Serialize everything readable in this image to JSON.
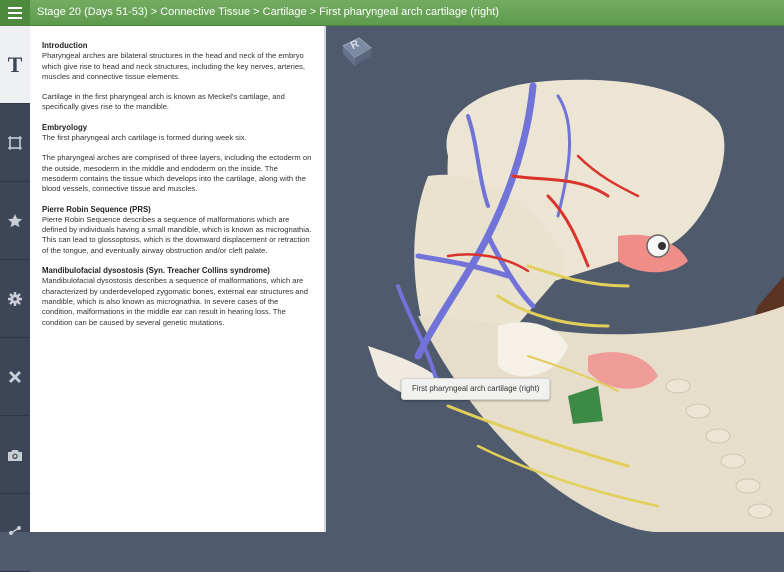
{
  "header": {
    "breadcrumb": "Stage 20 (Days 51-53) > Connective Tissue > Cartilage > First pharyngeal arch cartilage (right)"
  },
  "sidebar": {
    "items": [
      {
        "id": "text",
        "icon": "text-icon",
        "label": "T",
        "active": true
      },
      {
        "id": "views",
        "icon": "frame-icon"
      },
      {
        "id": "favorites",
        "icon": "star-icon"
      },
      {
        "id": "settings",
        "icon": "gear-icon"
      },
      {
        "id": "tools",
        "icon": "cross-tools-icon"
      },
      {
        "id": "camera",
        "icon": "camera-icon"
      },
      {
        "id": "share",
        "icon": "share-icon"
      }
    ]
  },
  "content": {
    "intro_heading": "Introduction",
    "intro_p1": "Pharyngeal arches are bilateral structures in the head and neck of the embryo which give rise to head and neck structures, including the key nerves, arteries, muscles and connective tissue elements.",
    "intro_p2": "Cartilage in the first pharyngeal arch is known as Meckel's cartilage, and specifically gives rise to the mandible.",
    "embryology_heading": "Embryology",
    "embryology_p1": "The first pharyngeal arch cartilage is formed during week six.",
    "embryology_p2": "The pharyngeal arches are comprised of three layers, including the ectoderm on the outside, mesoderm in the middle and endoderm on the inside. The mesoderm contains the tissue which develops into the cartilage, along with the blood vessels, connective tissue and muscles.",
    "prs_heading": "Pierre Robin Sequence (PRS)",
    "prs_p": "Pierre Robin Sequence describes a sequence of malformations which are defined by individuals having a small mandible, which is known as micrognathia. This can lead to glossoptosis, which is the downward displacement or retraction of the tongue, and eventually airway obstruction and/or cleft palate.",
    "md_heading": "Mandibulofacial dysostosis (Syn. Treacher Collins syndrome)",
    "md_p": "Mandibulofacial dysostosis describes a sequence of malformations, which are characterized by underdeveloped zygomatic bones, external ear structures and mandible, which is also known as micrognathia. In severe cases of the condition, malformations in the middle ear can result in hearing loss. The condition can be caused by several genetic mutations."
  },
  "viewer": {
    "orientation_cube_label": "R",
    "tooltip": "First pharyngeal arch cartilage (right)"
  },
  "colors": {
    "header_green": "#66a455",
    "sidebar": "#3d4656",
    "viewport_bg": "#4f5a6d",
    "vein_blue": "#7273d8",
    "artery_red": "#d9332c",
    "nerve_yellow": "#e2cf5a",
    "tissue_beige": "#e8e2d0"
  }
}
